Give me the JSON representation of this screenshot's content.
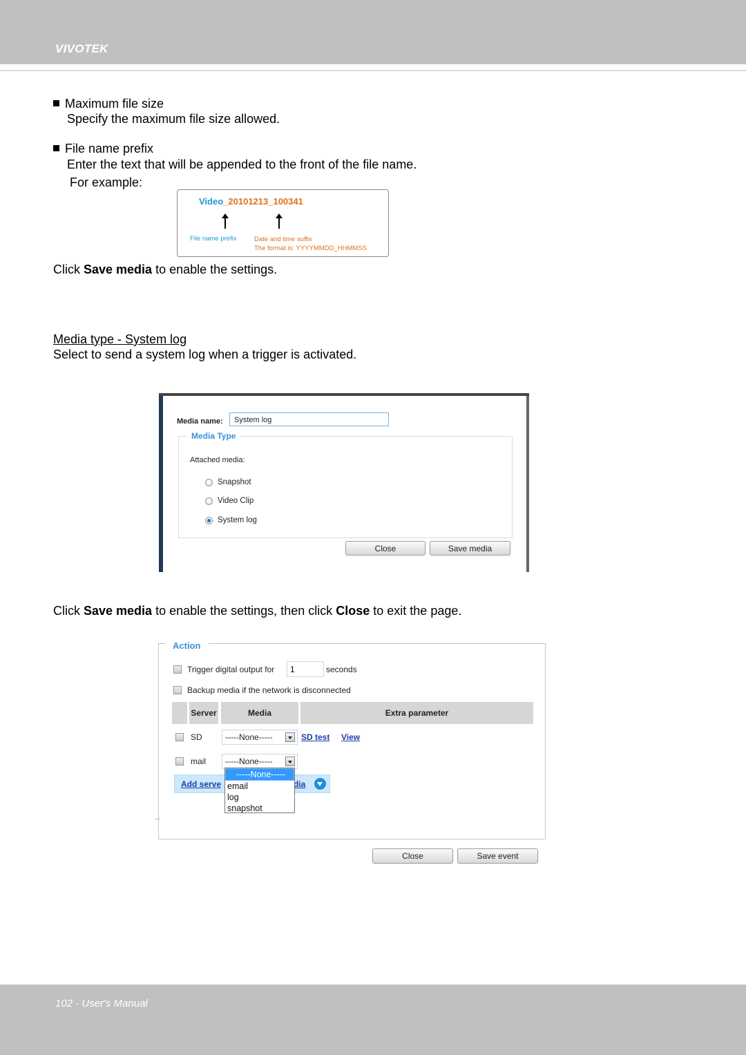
{
  "header": {
    "brand": "VIVOTEK"
  },
  "footer": {
    "page_label": "102 - User's Manual"
  },
  "sections": {
    "max_file_size": {
      "title": "Maximum file size",
      "desc": "Specify the maximum file size allowed."
    },
    "file_name_prefix": {
      "title": "File name prefix",
      "desc": "Enter the text that will be appended to the front of the file name.",
      "example_label": "For example:"
    },
    "example": {
      "prefix": "Video",
      "suffix": "_20101213_100341",
      "prefix_label": "File name prefix",
      "suffix_label": "Date and time suffix",
      "format_label": "The format is: YYYYMMDD_HHMMSS",
      "prefix_color": "#1a9ad6",
      "suffix_color": "#e0701e"
    },
    "save_note": {
      "pre": "Click ",
      "bold": "Save media",
      "post": " to enable the settings."
    },
    "system_log": {
      "title": "Media type - System log",
      "desc": "Select to send a system log when a trigger is activated."
    },
    "close_note": {
      "pre": "Click ",
      "bold1": "Save media",
      "mid": " to enable the settings, then click ",
      "bold2": "Close",
      "post": " to exit the page."
    }
  },
  "media_dialog": {
    "media_name_label": "Media name:",
    "media_name_value": "System log",
    "media_type_legend": "Media Type",
    "attached_media_label": "Attached media:",
    "options": [
      {
        "label": "Snapshot",
        "checked": false
      },
      {
        "label": "Video Clip",
        "checked": false
      },
      {
        "label": "System log",
        "checked": true
      }
    ],
    "close_button": "Close",
    "save_button": "Save media"
  },
  "action_panel": {
    "legend": "Action",
    "trigger_label": "Trigger digital output for",
    "trigger_value": "1",
    "trigger_unit": "seconds",
    "backup_label": "Backup media if the network is disconnected",
    "columns": [
      "Server",
      "Media",
      "Extra parameter"
    ],
    "rows": [
      {
        "server": "SD",
        "media": "-----None-----",
        "links": [
          "SD test",
          "View"
        ]
      },
      {
        "server": "mail",
        "media": "-----None-----",
        "links": []
      }
    ],
    "add_link_left": "Add serve",
    "add_link_right": "dia",
    "dropdown_options": [
      "-----None-----",
      "email",
      "log",
      "snapshot"
    ],
    "dropdown_selected": "-----None-----",
    "close_button": "Close",
    "save_button": "Save event"
  }
}
